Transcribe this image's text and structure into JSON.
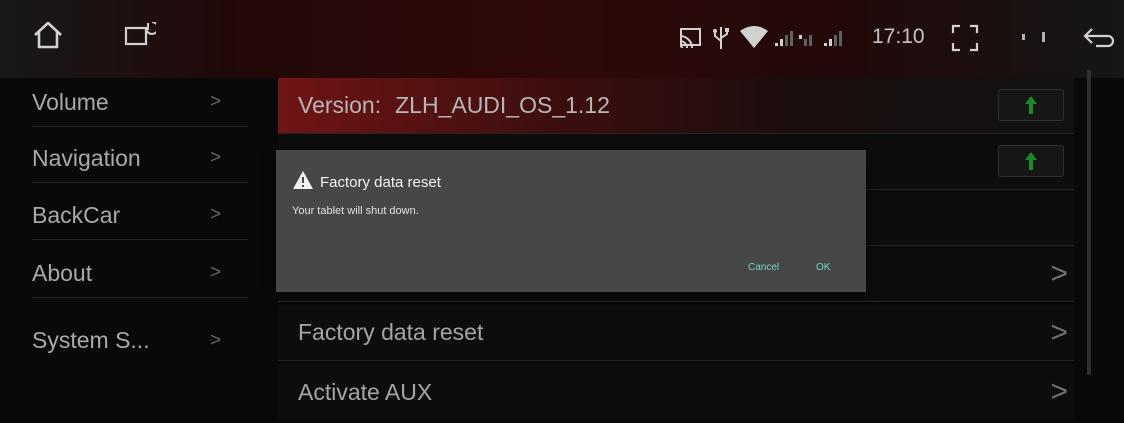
{
  "status": {
    "time": "17:10",
    "icons": [
      "home-icon",
      "power-menu-icon",
      "cast-icon",
      "usb-icon",
      "wifi-icon",
      "signal-icon",
      "signal-icon",
      "expand-icon",
      "back-icon"
    ]
  },
  "sidebar": {
    "items": [
      {
        "label": "Volume",
        "chevron": ">"
      },
      {
        "label": "Navigation",
        "chevron": ">"
      },
      {
        "label": "BackCar",
        "chevron": ">"
      },
      {
        "label": "About",
        "chevron": ">"
      },
      {
        "label": "System S...",
        "chevron": ">"
      }
    ]
  },
  "settings": {
    "version_label": "Version:",
    "version_value": "ZLH_AUDI_OS_1.12",
    "rows": [
      {
        "label": "Factory data reset",
        "chevron": ">"
      },
      {
        "label": "Activate AUX",
        "chevron": ">"
      }
    ],
    "row_chevron": ">"
  },
  "dialog": {
    "title": "Factory data reset",
    "message": "Your tablet will shut down.",
    "cancel": "Cancel",
    "ok": "OK"
  },
  "colors": {
    "accent": "#6fd3c6",
    "update_arrow": "#1faa2e",
    "version_row": "#8a1a1a"
  }
}
